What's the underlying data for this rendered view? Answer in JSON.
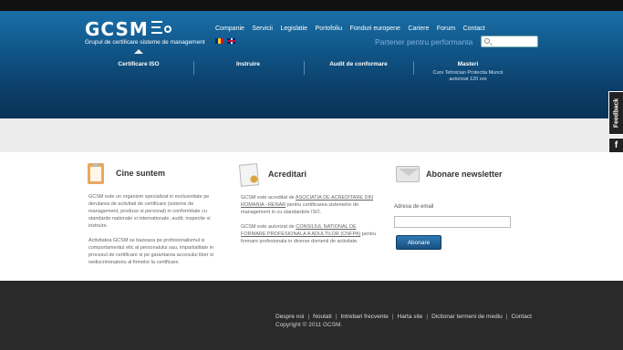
{
  "brand": {
    "logo_text": "GCSM",
    "tagline": "Grupul de certificare sisteme de management"
  },
  "nav": {
    "items": [
      "Companie",
      "Servicii",
      "Legislatie",
      "Portofoliu",
      "Fonduri europene",
      "Cariere",
      "Forum",
      "Contact"
    ]
  },
  "languages": {
    "ro": "ro-flag-icon",
    "en": "uk-flag-icon"
  },
  "motto": "Partener pentru performanta",
  "search": {
    "placeholder": "",
    "icon": "search-icon"
  },
  "tabs": [
    {
      "label": "Certificare ISO"
    },
    {
      "label": "Instruire"
    },
    {
      "label": "Audit de conformare"
    },
    {
      "label": "Masteri",
      "sub1": "Curs Tehnician Protectia Muncii",
      "sub2": "autorizat 120 ore"
    }
  ],
  "about": {
    "title": "Cine suntem",
    "p1": "GCSM este un organism specializat in exclusivitate pe derularea de activitati de certificare (sisteme de management, produse si personal) in conformitate cu standarde nationale si internationale, audit, inspectie si instruire.",
    "p2": "Activitatea GCSM se bazeaza pe profesionalismul si comportamentul etic al personalului sau, impartialitate in procesul de certificare si pe garantarea accesului liber si nediscriminatoriu al firmelor la certificare."
  },
  "accreditations": {
    "title": "Acreditari",
    "p1_a": "GCSM este acreditat de ",
    "p1_link": "ASOCIATIA DE ACREDITARE DIN ROMANIA –RENAR",
    "p1_b": " pentru certificarea sistemelor de management in cu standardele ISO.",
    "p2_a": "GCSM este autorizat de ",
    "p2_link": "CONSILIUL NATIONAL DE FORMARE PROFESIONALA A ADULTILOR (CNFPA)",
    "p2_b": " pentru formare profesionala in diverse domenii de activitate."
  },
  "newsletter": {
    "title": "Abonare newsletter",
    "email_label": "Adresa de email",
    "email_value": "",
    "button": "Abonare"
  },
  "footer": {
    "links": [
      "Despre noi",
      "Noutati",
      "Intrebari frecvente",
      "Harta site",
      "Dictionar termeni de mediu",
      "Contact"
    ],
    "copyright": "Copyright © 2011 GCSM."
  },
  "side": {
    "feedback": "Feedback",
    "facebook": "f"
  }
}
